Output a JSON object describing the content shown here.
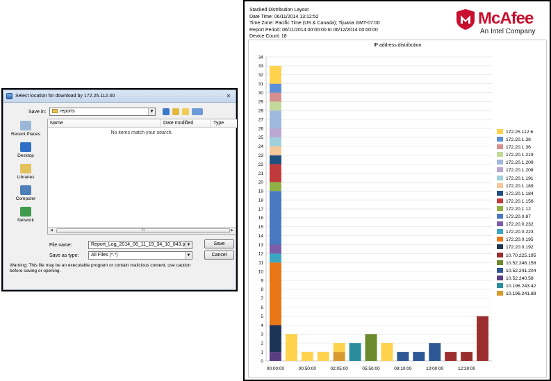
{
  "dialog": {
    "title": "Select location for download by 172.25.112.30",
    "save_in_label": "Save in:",
    "save_in_value": "reports",
    "places": [
      {
        "label": "Recent Places",
        "icon": "recent-places-icon",
        "color": "#9bb7d6"
      },
      {
        "label": "Desktop",
        "icon": "desktop-icon",
        "color": "#2f6fc6"
      },
      {
        "label": "Libraries",
        "icon": "libraries-icon",
        "color": "#e3c25e"
      },
      {
        "label": "Computer",
        "icon": "computer-icon",
        "color": "#4d7fb8"
      },
      {
        "label": "Network",
        "icon": "network-icon",
        "color": "#3f9a4a"
      }
    ],
    "columns": [
      "Name",
      "Date modified",
      "Type"
    ],
    "empty_message": "No items match your search.",
    "scroll_grip": "III",
    "file_name_label": "File name:",
    "file_name_value": "Report_Log_2014_06_11_19_34_10_843.pdf",
    "save_as_label": "Save as type:",
    "save_as_value": "All Files (*.*)",
    "save_button": "Save",
    "cancel_button": "Cancel",
    "warning": "Warning: This file may be an executable program or contain malicious content, use caution before saving or opening."
  },
  "report": {
    "header_lines": [
      "Stacked Distribution Layout",
      "Date Time: 06/11/2014 13:12:52",
      "Time Zone: Pacific Time (US & Canada); Tijuana GMT-07:00",
      "Report Period: 06/11/2014 00:00:00 to 06/12/2014 00:00:00",
      "Device Count: 18"
    ],
    "logo_text": "McAfee",
    "logo_subtext": "An Intel Company",
    "brand_color": "#c8102e"
  },
  "chart_data": {
    "type": "bar",
    "stacked": true,
    "title": "IP address distribution",
    "ylim": [
      0,
      34
    ],
    "yticks": [
      0,
      1,
      2,
      3,
      4,
      5,
      6,
      7,
      8,
      9,
      10,
      11,
      12,
      13,
      14,
      15,
      16,
      17,
      18,
      19,
      20,
      21,
      22,
      23,
      24,
      25,
      26,
      27,
      28,
      29,
      30,
      31,
      32,
      33,
      34
    ],
    "x_tick_labels": [
      "00:00:00",
      "00:50:00",
      "02:05:00",
      "05:50:00",
      "09:10:00",
      "10:00:00",
      "12:30:00"
    ],
    "x_tick_bar_index": [
      0,
      2,
      4,
      6,
      8,
      10,
      12
    ],
    "grid": true,
    "legend_position": "right",
    "legend": [
      {
        "name": "172.25.112.6",
        "color": "#ffd24d"
      },
      {
        "name": "172.20.1.38",
        "color": "#5b8fd6"
      },
      {
        "name": "172.20.1.36",
        "color": "#d68f8f"
      },
      {
        "name": "172.20.1.219",
        "color": "#c3d99a"
      },
      {
        "name": "172.20.1.209",
        "color": "#9fb8dd"
      },
      {
        "name": "172.20.1.208",
        "color": "#b9a6d2"
      },
      {
        "name": "172.20.1.191",
        "color": "#9fd0dc"
      },
      {
        "name": "172.20.1.189",
        "color": "#f5c79a"
      },
      {
        "name": "172.20.1.184",
        "color": "#1f4e80"
      },
      {
        "name": "172.20.1.156",
        "color": "#c0393b"
      },
      {
        "name": "172.20.1.12",
        "color": "#8fb042"
      },
      {
        "name": "172.20.0.87",
        "color": "#4878c0"
      },
      {
        "name": "172.20.0.232",
        "color": "#7b5ca8"
      },
      {
        "name": "172.20.0.223",
        "color": "#3aa6c2"
      },
      {
        "name": "172.20.0.195",
        "color": "#ea7616"
      },
      {
        "name": "172.20.0.192",
        "color": "#1c3557"
      },
      {
        "name": "10.70.225.195",
        "color": "#9a2d2d"
      },
      {
        "name": "10.52.246.158",
        "color": "#6b8b2c"
      },
      {
        "name": "10.52.241.204",
        "color": "#2c5694"
      },
      {
        "name": "10.52.240.58",
        "color": "#5a3c82"
      },
      {
        "name": "10.196.243.42",
        "color": "#2a8d9e"
      },
      {
        "name": "10.196.241.88",
        "color": "#d89a2c"
      }
    ],
    "bars": [
      [
        {
          "name": "10.52.240.58",
          "value": 1
        },
        {
          "name": "172.20.0.192",
          "value": 3
        },
        {
          "name": "172.20.0.195",
          "value": 7
        },
        {
          "name": "172.20.0.223",
          "value": 1
        },
        {
          "name": "172.20.0.232",
          "value": 1
        },
        {
          "name": "172.20.0.87",
          "value": 6
        },
        {
          "name": "172.20.1.12",
          "value": 1
        },
        {
          "name": "172.20.1.156",
          "value": 2
        },
        {
          "name": "172.20.1.184",
          "value": 1
        },
        {
          "name": "172.20.1.189",
          "value": 1
        },
        {
          "name": "172.20.1.191",
          "value": 1
        },
        {
          "name": "172.20.1.208",
          "value": 1
        },
        {
          "name": "172.20.1.209",
          "value": 2
        },
        {
          "name": "172.20.1.219",
          "value": 1
        },
        {
          "name": "172.20.1.36",
          "value": 1
        },
        {
          "name": "172.20.1.38",
          "value": 1
        },
        {
          "name": "172.25.112.6",
          "value": 2
        }
      ],
      [
        {
          "name": "172.25.112.6",
          "value": 3
        }
      ],
      [
        {
          "name": "172.25.112.6",
          "value": 1
        }
      ],
      [
        {
          "name": "172.25.112.6",
          "value": 1
        }
      ],
      [
        {
          "name": "10.196.241.88",
          "value": 1
        },
        {
          "name": "172.25.112.6",
          "value": 1
        }
      ],
      [
        {
          "name": "10.196.243.42",
          "value": 2
        }
      ],
      [
        {
          "name": "10.52.246.158",
          "value": 3
        }
      ],
      [
        {
          "name": "172.25.112.6",
          "value": 2
        }
      ],
      [
        {
          "name": "10.52.241.204",
          "value": 1
        }
      ],
      [
        {
          "name": "10.52.241.204",
          "value": 1
        }
      ],
      [
        {
          "name": "10.52.241.204",
          "value": 2
        }
      ],
      [
        {
          "name": "10.70.225.195",
          "value": 1
        }
      ],
      [
        {
          "name": "10.70.225.195",
          "value": 1
        }
      ],
      [
        {
          "name": "10.70.225.195",
          "value": 5
        }
      ]
    ]
  }
}
